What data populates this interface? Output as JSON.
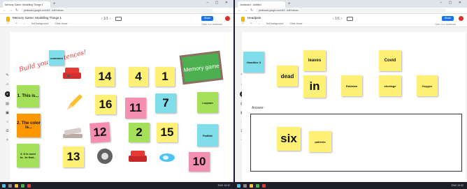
{
  "left": {
    "tab_title": "Memory Game: Modelling Things 1",
    "url": "jamboard.google.com/d/1...edit?viewer",
    "doc_title": "Memory Game: Modelling Things 1",
    "toolbar": {
      "set_background": "Set background",
      "clear_frame": "Clear frame"
    },
    "page_nav": "‹ 1/1 ›",
    "share_label": "Share",
    "exit_label": "Open in a Jamboard",
    "build_text": "Build your sentences!",
    "board_text": "Memory game",
    "notes": {
      "header": "comment",
      "sent1": "1. This is...",
      "sent2": "2. The color is...",
      "sent3": "3. It is used to...to that...",
      "n14": "14",
      "n4": "4",
      "n1": "1",
      "n16": "16",
      "n11": "11",
      "n7": "7",
      "n12": "12",
      "n2": "2",
      "n15": "15",
      "n13": "13",
      "n10": "10",
      "lugman": "Luqman",
      "fadilah": "Fadilah"
    }
  },
  "right": {
    "tab_title": "Jamboard - Untitled",
    "url": "jamboard.google.com/d/1...edit?viewer",
    "doc_title": "Headpain",
    "toolbar": {
      "set_background": "Set background",
      "clear_frame": "Clear frame"
    },
    "page_nav": "‹ 1/1 ›",
    "share_label": "Share",
    "exit_label": "Open in a Jamboard",
    "notes": {
      "headline": "Headline 3",
      "dead": "dead",
      "leaves": "leaves",
      "covid": "Covid",
      "in": "in",
      "pakistan": "Pakistan",
      "shortage": "shortage",
      "oxygen": "Oxygen",
      "six": "six",
      "patients": "patients"
    },
    "answer_label": "Answer:"
  },
  "taskbar": {
    "tray": "ENG 19:32"
  },
  "colors": {
    "accent": "#1a73e8",
    "sticky_yellow": "#fff176",
    "sticky_pink": "#f48fb1",
    "sticky_blue": "#80deea",
    "sticky_green": "#a4e05a",
    "sticky_orange": "#ff9800"
  }
}
